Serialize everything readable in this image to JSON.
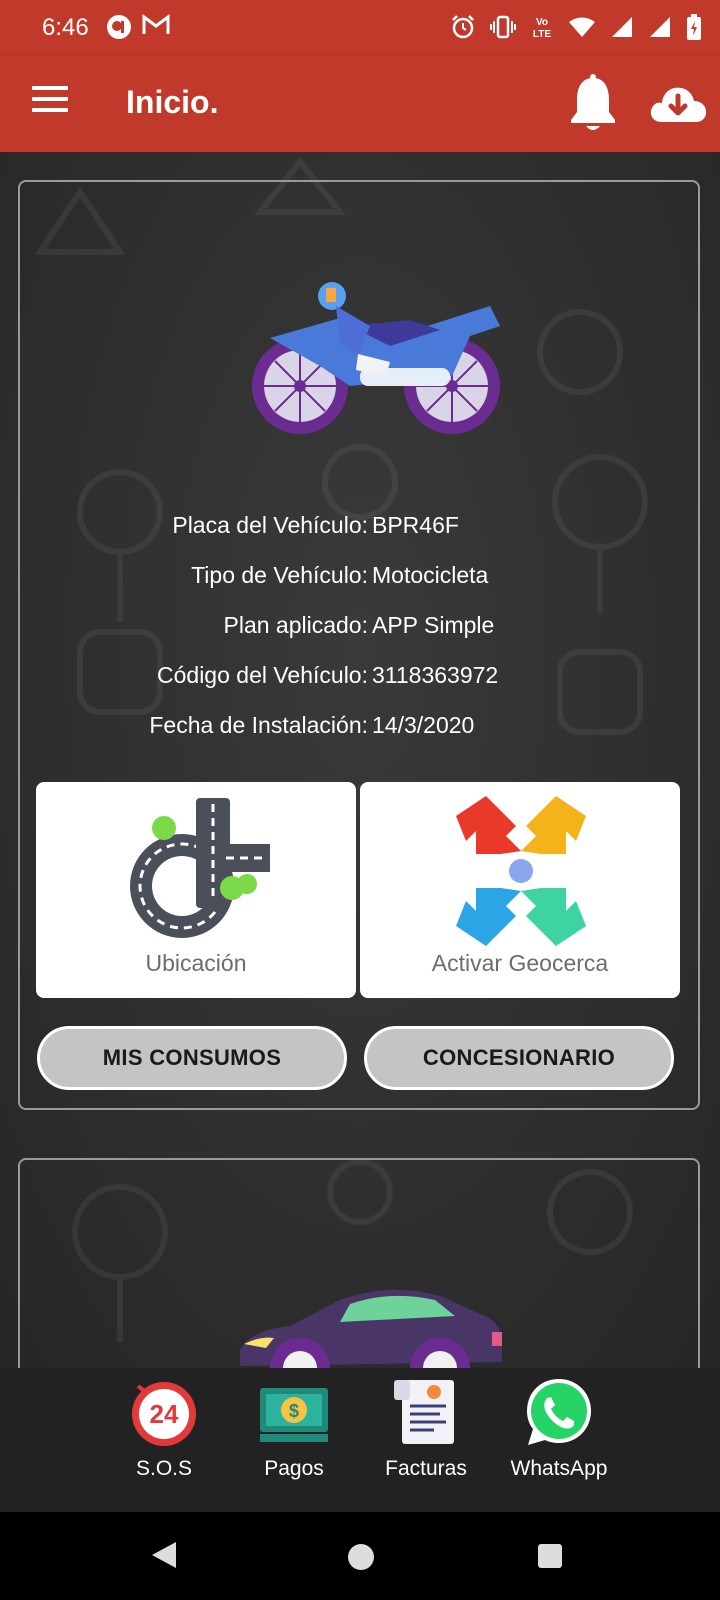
{
  "status_bar": {
    "time": "6:46",
    "left_icons": [
      "app-notification-icon",
      "gmail-icon"
    ],
    "right_icons": [
      "alarm-icon",
      "vibrate-icon",
      "volte-icon",
      "wifi-icon",
      "signal-icon",
      "signal-icon",
      "battery-icon"
    ],
    "volte_text": "Vo LTE"
  },
  "app_bar": {
    "title": "Inicio.",
    "color": "#c0392b",
    "icons": [
      "menu-icon",
      "bell-icon",
      "cloud-download-icon"
    ]
  },
  "vehicle_card": {
    "image": "motorcycle-illustration",
    "details": [
      {
        "label": "Placa del Vehículo:",
        "value": "BPR46F"
      },
      {
        "label": "Tipo de Vehículo:",
        "value": "Motocicleta"
      },
      {
        "label": "Plan aplicado:",
        "value": "APP Simple"
      },
      {
        "label": "Código del Vehículo:",
        "value": "3118363972"
      },
      {
        "label": "Fecha de Instalación:",
        "value": "14/3/2020"
      }
    ],
    "tiles": [
      {
        "label": "Ubicación",
        "icon": "road-location-icon"
      },
      {
        "label": "Activar Geocerca",
        "icon": "geofence-arrows-icon"
      }
    ],
    "buttons": [
      "MIS CONSUMOS",
      "CONCESIONARIO"
    ]
  },
  "second_card": {
    "image": "car-illustration"
  },
  "quick_bar": [
    {
      "label": "S.O.S",
      "icon": "sos-24-icon"
    },
    {
      "label": "Pagos",
      "icon": "money-icon"
    },
    {
      "label": "Facturas",
      "icon": "invoice-icon"
    },
    {
      "label": "WhatsApp",
      "icon": "whatsapp-icon"
    }
  ],
  "nav_bar": [
    "back-icon",
    "home-icon",
    "recents-icon"
  ]
}
